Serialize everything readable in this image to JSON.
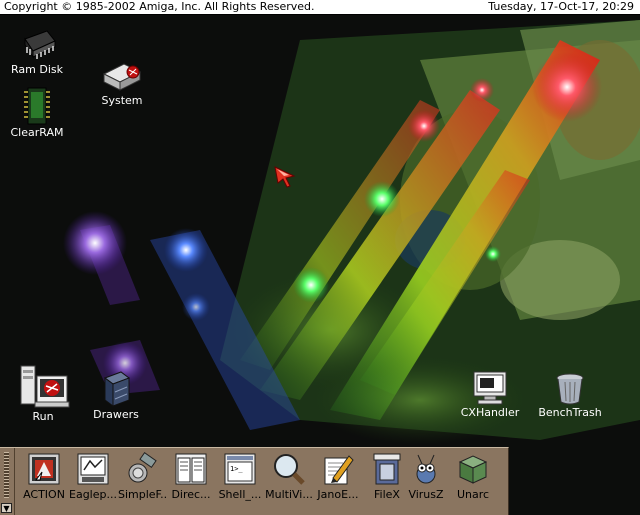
{
  "menubar": {
    "copyright": "Copyright © 1985-2002 Amiga, Inc. All Rights Reserved.",
    "clock": "Tuesday, 17-Oct-17, 20:29"
  },
  "desktop_icons": [
    {
      "label": "Ram Disk",
      "icon": "ram-chip-icon"
    },
    {
      "label": "System",
      "icon": "system-drive-icon"
    },
    {
      "label": "ClearRAM",
      "icon": "clearram-chip-icon"
    },
    {
      "label": "Run",
      "icon": "run-computer-icon"
    },
    {
      "label": "Drawers",
      "icon": "drawers-cabinet-icon"
    },
    {
      "label": "CXHandler",
      "icon": "cxhandler-monitor-icon"
    },
    {
      "label": "BenchTrash",
      "icon": "trash-can-icon"
    }
  ],
  "dock": {
    "items": [
      {
        "label": "ACTION",
        "icon": "action-icon"
      },
      {
        "label": "Eaglep...",
        "icon": "eagleplayer-icon"
      },
      {
        "label": "SimpleF...",
        "icon": "simplefind-icon"
      },
      {
        "label": "Direc...",
        "icon": "directory-opus-icon"
      },
      {
        "label": "Shell_...",
        "icon": "shell-icon"
      },
      {
        "label": "MultiVi...",
        "icon": "multiview-magnifier-icon"
      },
      {
        "label": "JanoE...",
        "icon": "janoeditor-pencil-icon"
      },
      {
        "label": "FileX",
        "icon": "filex-icon"
      },
      {
        "label": "VirusZ",
        "icon": "virusz-bug-icon"
      },
      {
        "label": "Unarc",
        "icon": "unarc-cube-icon"
      }
    ]
  },
  "colors": {
    "menubar_bg": "#ffffff",
    "dock_bg": "#8a7560",
    "desktop_bg": "#0c0d0c"
  }
}
